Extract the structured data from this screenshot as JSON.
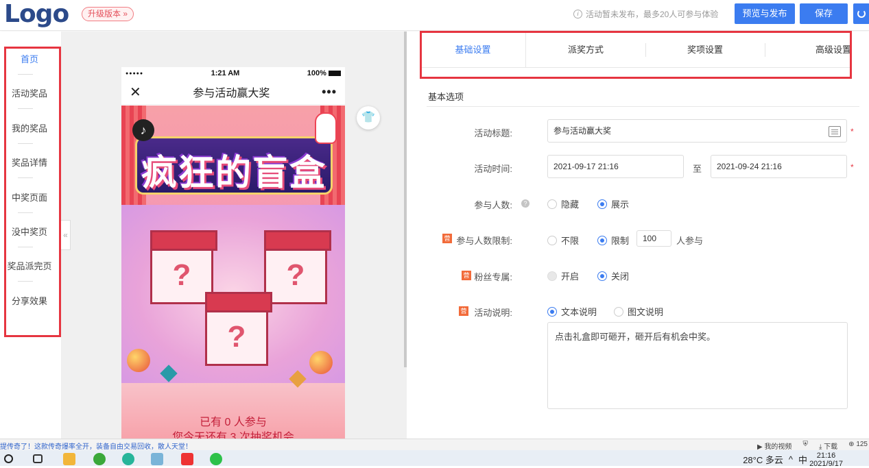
{
  "header": {
    "logo": "Logo",
    "upgrade_label": "升级版本 »",
    "notice": "活动暂未发布，最多20人可参与体验",
    "preview_publish_label": "预览与发布",
    "save_label": "保存"
  },
  "sidebar": {
    "items": [
      {
        "label": "首页",
        "active": true
      },
      {
        "label": "活动奖品"
      },
      {
        "label": "我的奖品"
      },
      {
        "label": "奖品详情"
      },
      {
        "label": "中奖页面"
      },
      {
        "label": "没中奖页"
      },
      {
        "label": "奖品派完页"
      },
      {
        "label": "分享效果"
      }
    ],
    "collapse_glyph": "«"
  },
  "phone": {
    "signal": "●●●●●",
    "time": "1:21 AM",
    "battery": "100%",
    "close_glyph": "✕",
    "title": "参与活动赢大奖",
    "more_glyph": "•••",
    "banner_title": "疯狂的盲盒",
    "box_mark": "?",
    "join_text": "已有 0 人参与",
    "chance_text": "您今天还有 3 次抽奖机会"
  },
  "tabs": [
    {
      "label": "基础设置",
      "active": true
    },
    {
      "label": "派奖方式"
    },
    {
      "label": "奖项设置"
    },
    {
      "label": "高级设置"
    }
  ],
  "form": {
    "section_title": "基本选项",
    "title_label": "活动标题:",
    "title_value": "参与活动赢大奖",
    "time_label": "活动时间:",
    "start_time": "2021-09-17 21:16",
    "time_sep": "至",
    "end_time": "2021-09-24 21:16",
    "participants_label": "参与人数:",
    "participants_options": [
      "隐藏",
      "展示"
    ],
    "participants_selected": "展示",
    "limit_label": "参与人数限制:",
    "limit_options": [
      "不限",
      "限制"
    ],
    "limit_selected": "限制",
    "limit_value": "100",
    "limit_suffix": "人参与",
    "fans_label": "粉丝专属:",
    "fans_options": [
      "开启",
      "关闭"
    ],
    "fans_selected": "关闭",
    "desc_label": "活动说明:",
    "desc_options": [
      "文本说明",
      "图文说明"
    ],
    "desc_selected": "文本说明",
    "desc_text": "点击礼盒即可砸开，砸开后有机会中奖。",
    "badge_text": "营",
    "required_mark": "*",
    "help_glyph": "?"
  },
  "browser_status": {
    "left_text": "提传奇了！这款传奇爆率全开，装备自由交易回收，散人天堂！",
    "video_label": "我的视频",
    "download_label": "下载",
    "zoom": "125"
  },
  "taskbar": {
    "weather": "28°C 多云",
    "ime": "中",
    "time": "21:16",
    "date": "2021/9/17"
  },
  "colors": {
    "primary": "#3b7cf0",
    "highlight_red": "#e63540",
    "badge_orange": "#f26b3a"
  }
}
